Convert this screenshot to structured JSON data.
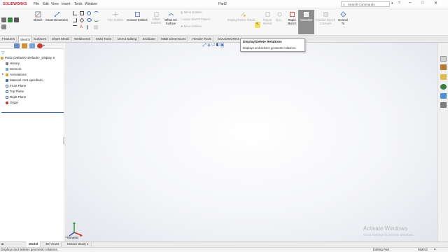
{
  "app": {
    "logo_text": "SOLIDWORKS",
    "document_title": "Part2"
  },
  "menu": [
    "File",
    "Edit",
    "View",
    "Insert",
    "Tools",
    "Window"
  ],
  "search": {
    "placeholder": "Search Commands"
  },
  "window_controls": {
    "minimize": "–",
    "maximize": "□",
    "close": "✕"
  },
  "command_manager": {
    "sketch": "Sketch",
    "smart_dimension": "Smart Dimension",
    "trim_entities": "Trim Entities",
    "convert_entities": "Convert Entities",
    "offset_entities": "Offset Entities",
    "offset_on_surface_1": "Offset On",
    "offset_on_surface_2": "Surface",
    "mirror_entities": "Mirror Entities",
    "linear_sketch_pattern": "Linear Sketch Pattern",
    "move_entities": "Move Entities",
    "display_delete_relations": "Display/Delete Relati...",
    "repair_sketch_1": "Repair",
    "repair_sketch_2": "Sketch",
    "quick_snaps": "Qui...",
    "rapid_sketch_1": "Rapid",
    "rapid_sketch_2": "Sketch",
    "instant2d": "Instant2D",
    "shaded_sketch_1": "Shaded Sketch",
    "shaded_sketch_2": "Contours",
    "normal_to_1": "Normal",
    "normal_to_2": "To"
  },
  "tabs": [
    "Features",
    "Sketch",
    "Surfaces",
    "Sheet Metal",
    "Weldments",
    "Mold Tools",
    "Direct Editing",
    "Evaluate",
    "MBD Dimensions",
    "Render Tools",
    "SOLIDWORKS"
  ],
  "tree": {
    "root": "Part2  (Default<<Default>_Display S",
    "items": [
      "History",
      "Sensors",
      "Annotations",
      "Material <not specified>",
      "Front Plane",
      "Top Plane",
      "Right Plane",
      "Origin"
    ]
  },
  "tooltip": {
    "title": "Display/Delete Relations",
    "body": "Displays and deletes geometric relations."
  },
  "viewport": {
    "orientation": "*Trimetric"
  },
  "watermark": {
    "line1": "Activate Windows",
    "line2": "Go to Settings to activate Windows."
  },
  "bottom_tabs": [
    "Model",
    "3D Views",
    "Motion Study 1"
  ],
  "status": {
    "message": "Displays and deletes geometric relations.",
    "mode": "Editing Part",
    "units": "MMGS"
  },
  "colors": {
    "brand": "#d6202e",
    "accent": "#2b5aa8",
    "active_button": "#8e8e8e"
  }
}
